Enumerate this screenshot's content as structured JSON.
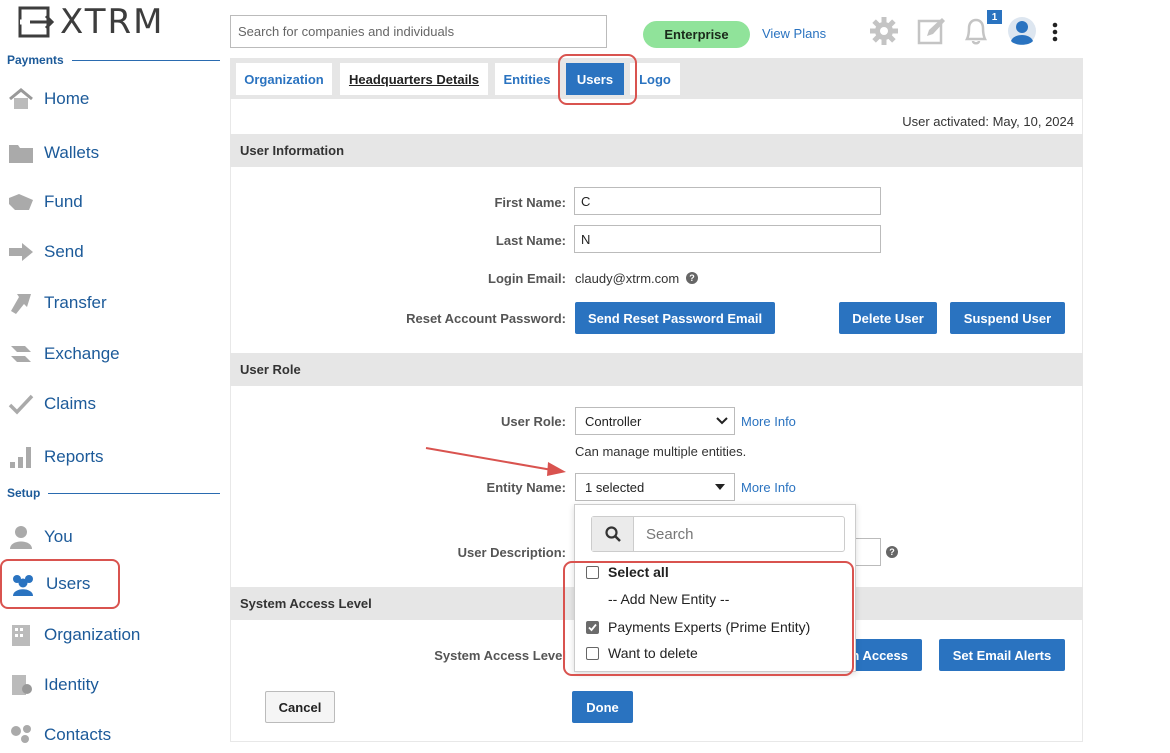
{
  "brand": {
    "logo_text": "XTRM"
  },
  "sidebar": {
    "payments_title": "Payments",
    "setup_title": "Setup",
    "payments_items": [
      {
        "label": "Home",
        "icon": "home-icon"
      },
      {
        "label": "Wallets",
        "icon": "folder-icon"
      },
      {
        "label": "Fund",
        "icon": "fund-icon"
      },
      {
        "label": "Send",
        "icon": "arrow-right-icon"
      },
      {
        "label": "Transfer",
        "icon": "transfer-icon"
      },
      {
        "label": "Exchange",
        "icon": "exchange-icon"
      },
      {
        "label": "Claims",
        "icon": "checkmark-icon"
      },
      {
        "label": "Reports",
        "icon": "bar-chart-icon"
      }
    ],
    "setup_items": [
      {
        "label": "You",
        "icon": "person-icon"
      },
      {
        "label": "Users",
        "icon": "users-icon",
        "active": true
      },
      {
        "label": "Organization",
        "icon": "building-icon"
      },
      {
        "label": "Identity",
        "icon": "identity-icon"
      },
      {
        "label": "Contacts",
        "icon": "contacts-icon"
      }
    ]
  },
  "topbar": {
    "search_placeholder": "Search for companies and individuals",
    "plan_badge": "Enterprise",
    "view_plans": "View Plans",
    "notification_count": "1",
    "icons": [
      "gear-icon",
      "edit-icon",
      "bell-icon",
      "user-avatar-icon",
      "more-vertical-icon"
    ]
  },
  "tabs": {
    "organization": "Organization",
    "headquarters": "Headquarters Details",
    "entities": "Entities",
    "users": "Users",
    "logo": "Logo"
  },
  "main": {
    "user_activated": "User activated: May, 10, 2024",
    "user_info_header": "User Information",
    "first_name_label": "First Name:",
    "first_name_value": "C",
    "last_name_label": "Last Name:",
    "last_name_value": "N",
    "login_email_label": "Login Email:",
    "login_email_value": "claudy@xtrm.com",
    "reset_password_label": "Reset Account Password:",
    "send_reset_button": "Send Reset Password Email",
    "delete_user_button": "Delete User",
    "suspend_user_button": "Suspend User",
    "user_role_header": "User Role",
    "user_role_label": "User Role:",
    "user_role_value": "Controller",
    "more_info": "More Info",
    "role_description": "Can manage multiple entities.",
    "entity_name_label": "Entity Name:",
    "entity_selected": "1 selected",
    "user_description_label": "User Description:",
    "system_access_header": "System Access Level",
    "system_access_label": "System Access Level",
    "access_button_partial": "n Access",
    "email_alerts_button": "Set Email Alerts",
    "cancel_button": "Cancel",
    "done_button": "Done"
  },
  "entity_dropdown": {
    "search_placeholder": "Search",
    "select_all": "Select all",
    "add_new": "-- Add New Entity --",
    "options": [
      {
        "label": "Payments Experts (Prime Entity)",
        "checked": true
      },
      {
        "label": "Want to delete",
        "checked": false
      }
    ]
  },
  "colors": {
    "accent": "#2a73c0",
    "highlight": "#d9534f",
    "enterprise": "#90e39a"
  }
}
